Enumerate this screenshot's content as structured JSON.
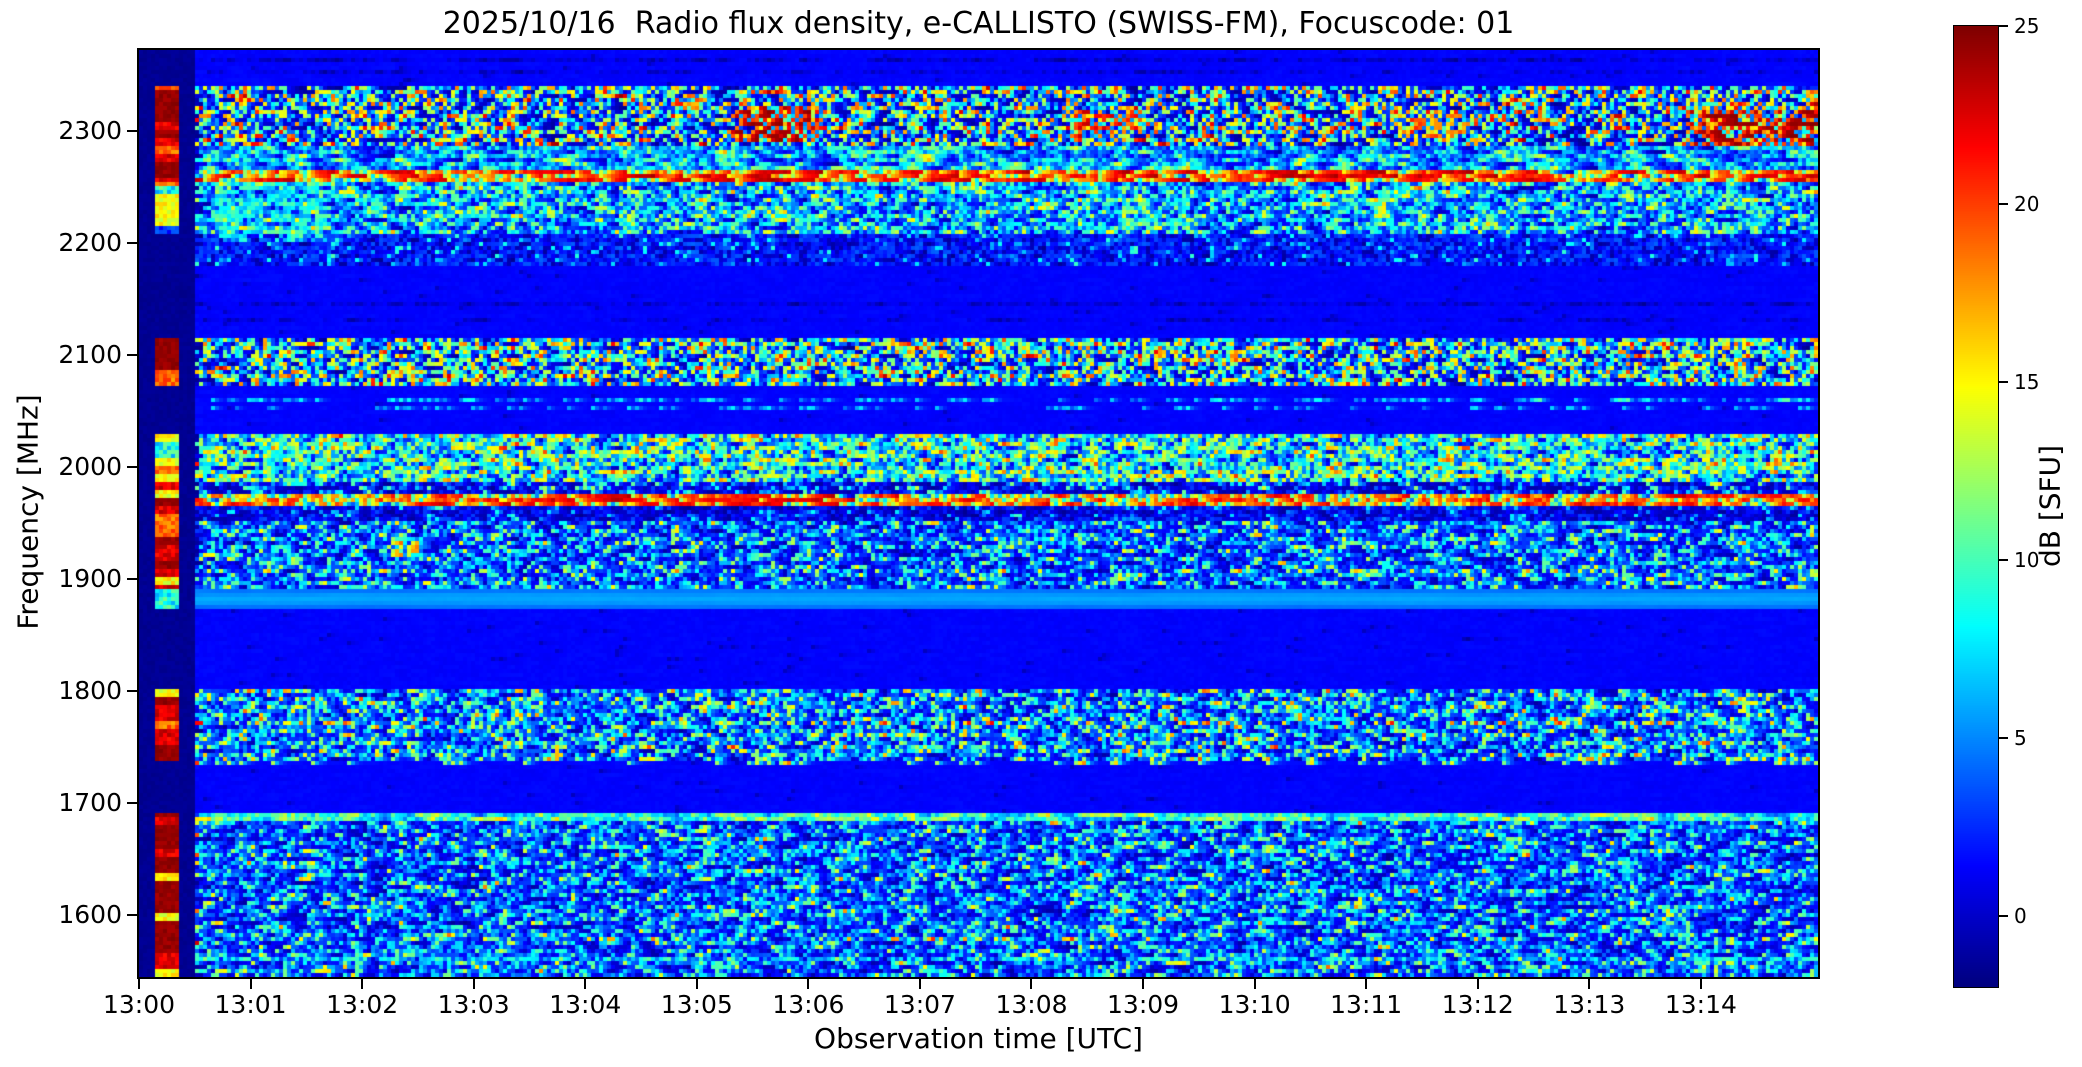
{
  "figure": {
    "background": "#ffffff"
  },
  "chart_data": {
    "type": "heatmap",
    "title": "2025/10/16  Radio flux density, e-CALLISTO (SWISS-FM), Focuscode: 01",
    "xlabel": "Observation time [UTC]",
    "ylabel": "Frequency [MHz]",
    "colormap": "jet",
    "x_axis": {
      "tick_labels": [
        "13:00",
        "13:01",
        "13:02",
        "13:03",
        "13:04",
        "13:05",
        "13:06",
        "13:07",
        "13:08",
        "13:09",
        "13:10",
        "13:11",
        "13:12",
        "13:13",
        "13:14"
      ],
      "tick_minutes": [
        0,
        1,
        2,
        3,
        4,
        5,
        6,
        7,
        8,
        9,
        10,
        11,
        12,
        13,
        14
      ],
      "start_time": "13:00",
      "total_minutes": 15.05
    },
    "y_axis": {
      "tick_labels": [
        "2300",
        "2200",
        "2100",
        "2000",
        "1900",
        "1800",
        "1700",
        "1600"
      ],
      "tick_mhz": [
        2300,
        2200,
        2100,
        2000,
        1900,
        1800,
        1700,
        1600
      ],
      "range_mhz": [
        1545,
        2372
      ]
    },
    "colorbar": {
      "label": "dB [SFU]",
      "tick_labels": [
        "25",
        "20",
        "15",
        "10",
        "5",
        "0"
      ],
      "tick_values": [
        25,
        20,
        15,
        10,
        5,
        0
      ],
      "vmin": -2,
      "vmax": 25
    },
    "spectrogram": {
      "grid": {
        "cols": 420,
        "rows": 232,
        "seed": 20251016
      },
      "value_classes": {
        "navy": [
          -1.8,
          0.6
        ],
        "blue": [
          0.8,
          4.2
        ],
        "cyan": [
          5.5,
          11.5
        ],
        "yellow": [
          13.0,
          16.5
        ],
        "orange": [
          17.0,
          20.5
        ],
        "red": [
          21.0,
          23.8
        ],
        "darkred": [
          23.8,
          25.0
        ]
      },
      "calibration_sec": {
        "dark_start": 0,
        "bright_start": 9.5,
        "bright_end": 22,
        "dark_end": 30.5
      },
      "cal_palettes": {
        "darkred": [
          [
            "darkred",
            0.5
          ],
          [
            "red",
            0.2
          ],
          [
            "orange",
            0.18
          ],
          [
            "yellow",
            0.12
          ]
        ],
        "red": [
          [
            "red",
            0.45
          ],
          [
            "orange",
            0.25
          ],
          [
            "darkred",
            0.18
          ],
          [
            "yellow",
            0.12
          ]
        ],
        "yellow": [
          [
            "yellow",
            0.4
          ],
          [
            "orange",
            0.2
          ],
          [
            "cyan",
            0.3
          ],
          [
            "blue",
            0.1
          ]
        ],
        "mix": [
          [
            "cyan",
            0.3
          ],
          [
            "yellow",
            0.3
          ],
          [
            "orange",
            0.2
          ],
          [
            "red",
            0.2
          ]
        ],
        "cyan": [
          [
            "cyan",
            0.7
          ],
          [
            "blue",
            0.3
          ]
        ]
      },
      "bands": [
        {
          "f_mhz": [
            2372,
            2340
          ],
          "type": "flat",
          "base": 1.4,
          "corr": 0.4,
          "cal": "dark"
        },
        {
          "f_mhz": [
            2340,
            2287
          ],
          "type": "speckle",
          "corr": 0.25,
          "cal": "darkred",
          "w": {
            "navy": 0.38,
            "blue": 0.1,
            "cyan": 0.2,
            "yellow": 0.14,
            "orange": 0.09,
            "red": 0.06,
            "darkred": 0.03
          }
        },
        {
          "f_mhz": [
            2287,
            2266
          ],
          "type": "speckle",
          "corr": 0.55,
          "cal": "red",
          "w": {
            "navy": 0.35,
            "blue": 0.15,
            "cyan": 0.3,
            "yellow": 0.15,
            "orange": 0.05
          }
        },
        {
          "f_mhz": [
            2266,
            2256
          ],
          "type": "line",
          "corr": 0.6,
          "cal": "darkred",
          "w": {
            "navy": 0.12,
            "blue": 0.05,
            "cyan": 0.03,
            "orange": 0.15,
            "red": 0.45,
            "darkred": 0.2
          }
        },
        {
          "f_mhz": [
            2256,
            2208
          ],
          "type": "speckle",
          "corr": 0.35,
          "cal": "yellow",
          "w": {
            "navy": 0.2,
            "blue": 0.26,
            "cyan": 0.36,
            "yellow": 0.15,
            "orange": 0.03
          }
        },
        {
          "f_mhz": [
            2208,
            2178
          ],
          "type": "speckle",
          "corr": 0.2,
          "cal": "dark",
          "w": {
            "navy": 0.3,
            "blue": 0.62,
            "cyan": 0.08
          }
        },
        {
          "f_mhz": [
            2178,
            2115
          ],
          "type": "flat",
          "base": 1.4,
          "corr": 0.4,
          "cal": "dark"
        },
        {
          "f_mhz": [
            2115,
            2072
          ],
          "type": "speckle",
          "corr": 0.25,
          "cal": "darkred",
          "w": {
            "navy": 0.3,
            "blue": 0.12,
            "cyan": 0.27,
            "yellow": 0.16,
            "orange": 0.09,
            "red": 0.05,
            "darkred": 0.01
          }
        },
        {
          "f_mhz": [
            2072,
            2030
          ],
          "type": "flat",
          "base": 1.4,
          "corr": 0.4,
          "cal": "dark"
        },
        {
          "f_mhz": [
            2030,
            1988
          ],
          "type": "speckle",
          "corr": 0.35,
          "cal": "mix",
          "w": {
            "navy": 0.18,
            "blue": 0.15,
            "cyan": 0.34,
            "yellow": 0.23,
            "orange": 0.08,
            "red": 0.02
          }
        },
        {
          "f_mhz": [
            1988,
            1978
          ],
          "type": "speckle",
          "corr": 0.3,
          "cal": "red",
          "w": {
            "navy": 0.55,
            "blue": 0.25,
            "cyan": 0.15,
            "yellow": 0.05
          }
        },
        {
          "f_mhz": [
            1978,
            1964
          ],
          "type": "line",
          "corr": 0.55,
          "cal": "darkred",
          "w": {
            "navy": 0.18,
            "blue": 0.05,
            "cyan": 0.02,
            "yellow": 0.05,
            "orange": 0.2,
            "red": 0.4,
            "darkred": 0.1
          }
        },
        {
          "f_mhz": [
            1964,
            1950
          ],
          "type": "speckle",
          "corr": 0.3,
          "cal": "red",
          "w": {
            "navy": 0.5,
            "blue": 0.4,
            "cyan": 0.1
          }
        },
        {
          "f_mhz": [
            1950,
            1890
          ],
          "type": "speckle",
          "corr": 0.3,
          "cal": "red",
          "w": {
            "navy": 0.25,
            "blue": 0.38,
            "cyan": 0.26,
            "yellow": 0.09,
            "orange": 0.02
          }
        },
        {
          "f_mhz": [
            1890,
            1874
          ],
          "type": "glow",
          "base": 4.2,
          "corr": 0.85,
          "cal": "cyan"
        },
        {
          "f_mhz": [
            1874,
            1802
          ],
          "type": "flat",
          "base": 1.4,
          "corr": 0.4,
          "cal": "dark"
        },
        {
          "f_mhz": [
            1802,
            1738
          ],
          "type": "speckle",
          "corr": 0.3,
          "cal": "darkred",
          "w": {
            "navy": 0.24,
            "blue": 0.34,
            "cyan": 0.26,
            "yellow": 0.11,
            "orange": 0.04,
            "red": 0.01
          }
        },
        {
          "f_mhz": [
            1738,
            1692
          ],
          "type": "flat",
          "base": 1.4,
          "corr": 0.4,
          "cal": "dark"
        },
        {
          "f_mhz": [
            1692,
            1684
          ],
          "type": "line",
          "corr": 0.6,
          "cal": "darkred",
          "w": {
            "blue": 0.25,
            "cyan": 0.4,
            "yellow": 0.28,
            "orange": 0.07
          }
        },
        {
          "f_mhz": [
            1684,
            1545
          ],
          "type": "speckle",
          "corr": 0.35,
          "cal": "darkred",
          "w": {
            "navy": 0.3,
            "blue": 0.34,
            "cyan": 0.25,
            "yellow": 0.09,
            "orange": 0.015,
            "red": 0.005
          }
        }
      ],
      "dot_rows": [
        {
          "f_mhz": 2363,
          "class": "navy",
          "density": 0.5
        },
        {
          "f_mhz": 2352,
          "class": "navy",
          "density": 0.3
        },
        {
          "f_mhz": 2145,
          "class": "navy",
          "density": 0.45
        },
        {
          "f_mhz": 2131,
          "class": "navy",
          "density": 0.25
        },
        {
          "f_mhz": 2060,
          "class": "cyan",
          "density": 0.3
        },
        {
          "f_mhz": 2052,
          "class": "cyan",
          "density": 0.22
        },
        {
          "f_mhz": 1908,
          "class": "orange",
          "density": 0.08
        },
        {
          "f_mhz": 1772,
          "class": "red",
          "density": 0.1
        },
        {
          "f_mhz": 1737,
          "class": "orange",
          "density": 0.12
        },
        {
          "f_mhz": 1578,
          "class": "red",
          "density": 0.05
        },
        {
          "f_mhz": 1560,
          "class": "cyan",
          "density": 0.5
        }
      ],
      "hotspots": [
        {
          "t_min": 5.3,
          "t_max": 6.1,
          "f_min": 2290,
          "f_max": 2322,
          "class": "darkred",
          "p": 0.5
        },
        {
          "t_min": 13.85,
          "t_max": 15.05,
          "f_min": 2288,
          "f_max": 2320,
          "class": "darkred",
          "p": 0.55
        },
        {
          "t_min": 8.4,
          "t_max": 9.0,
          "f_min": 2290,
          "f_max": 2318,
          "class": "red",
          "p": 0.4
        },
        {
          "t_min": 11.3,
          "t_max": 11.9,
          "f_min": 2290,
          "f_max": 2315,
          "class": "orange",
          "p": 0.4
        },
        {
          "t_min": 0.7,
          "t_max": 1.7,
          "f_min": 2200,
          "f_max": 2255,
          "class": "cyan",
          "p": 0.5
        },
        {
          "t_min": 3.3,
          "t_max": 6.2,
          "f_min": 1964,
          "f_max": 1978,
          "class": "red",
          "p": 0.35
        },
        {
          "t_min": 2.25,
          "t_max": 2.5,
          "f_min": 1918,
          "f_max": 1934,
          "class": "orange",
          "p": 0.5
        }
      ]
    }
  }
}
